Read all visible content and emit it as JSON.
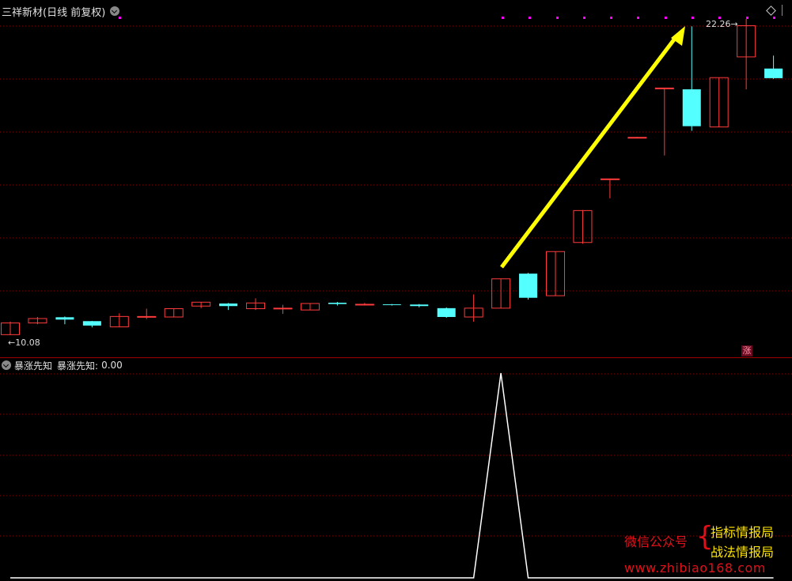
{
  "header": {
    "title": "三祥新材",
    "period": "(日线 前复权)"
  },
  "price_labels": {
    "low": "10.08",
    "high": "22.26"
  },
  "badge": "涨",
  "indicator": {
    "name": "暴涨先知",
    "value_label": "暴涨先知:",
    "value": "0.00"
  },
  "watermark": {
    "wechat": "微信公众号",
    "brace": "{",
    "line1": "指标情报局",
    "line2": "战法情报局",
    "url": "www.zhibiao168.com"
  },
  "colors": {
    "up": "#ff3b3b",
    "down": "#54ffff",
    "signal": "#ffff00",
    "grid": "#8b0000",
    "dots": "#ff00ff",
    "line": "#ffffff"
  },
  "chart_data": {
    "type": "candlestick",
    "scale": {
      "low": 10.08,
      "high": 22.26
    },
    "candles": [
      {
        "o": 10.1,
        "h": 10.6,
        "l": 10.08,
        "c": 10.55
      },
      {
        "o": 10.55,
        "h": 10.78,
        "l": 10.5,
        "c": 10.72
      },
      {
        "o": 10.77,
        "h": 10.8,
        "l": 10.5,
        "c": 10.68
      },
      {
        "o": 10.62,
        "h": 10.63,
        "l": 10.38,
        "c": 10.45
      },
      {
        "o": 10.4,
        "h": 10.92,
        "l": 10.38,
        "c": 10.8
      },
      {
        "o": 10.8,
        "h": 11.1,
        "l": 10.7,
        "c": 10.8
      },
      {
        "o": 10.78,
        "h": 11.1,
        "l": 10.77,
        "c": 11.1
      },
      {
        "o": 11.2,
        "h": 11.35,
        "l": 11.12,
        "c": 11.35
      },
      {
        "o": 11.3,
        "h": 11.32,
        "l": 11.05,
        "c": 11.2
      },
      {
        "o": 11.1,
        "h": 11.5,
        "l": 11.05,
        "c": 11.32
      },
      {
        "o": 11.12,
        "h": 11.25,
        "l": 10.9,
        "c": 11.12
      },
      {
        "o": 11.05,
        "h": 11.3,
        "l": 11.05,
        "c": 11.3
      },
      {
        "o": 11.33,
        "h": 11.36,
        "l": 11.22,
        "c": 11.28
      },
      {
        "o": 11.27,
        "h": 11.32,
        "l": 11.22,
        "c": 11.27
      },
      {
        "o": 11.27,
        "h": 11.28,
        "l": 11.22,
        "c": 11.26
      },
      {
        "o": 11.26,
        "h": 11.28,
        "l": 11.15,
        "c": 11.2
      },
      {
        "o": 11.12,
        "h": 11.15,
        "l": 10.75,
        "c": 10.78
      },
      {
        "o": 10.78,
        "h": 11.65,
        "l": 10.6,
        "c": 11.12
      },
      {
        "o": 11.12,
        "h": 12.25,
        "l": 11.12,
        "c": 12.25
      },
      {
        "o": 12.45,
        "h": 12.48,
        "l": 11.45,
        "c": 11.52
      },
      {
        "o": 11.6,
        "h": 13.3,
        "l": 11.6,
        "c": 13.3
      },
      {
        "o": 13.65,
        "h": 14.9,
        "l": 13.6,
        "c": 14.88
      },
      {
        "o": 16.08,
        "h": 16.1,
        "l": 15.35,
        "c": 16.1
      },
      {
        "o": 17.7,
        "h": 17.72,
        "l": 17.7,
        "c": 17.7
      },
      {
        "o": 19.57,
        "h": 19.6,
        "l": 17.0,
        "c": 19.6
      },
      {
        "o": 19.55,
        "h": 21.98,
        "l": 17.95,
        "c": 18.13
      },
      {
        "o": 18.1,
        "h": 20.0,
        "l": 18.1,
        "c": 20.0
      },
      {
        "o": 20.8,
        "h": 22.26,
        "l": 19.55,
        "c": 22.0
      },
      {
        "o": 20.35,
        "h": 20.85,
        "l": 19.95,
        "c": 19.98
      }
    ],
    "indicator_values": [
      0,
      0,
      0,
      0,
      0,
      0,
      0,
      0,
      0,
      0,
      0,
      0,
      0,
      0,
      0,
      0,
      0,
      0,
      1,
      0,
      0,
      0,
      0,
      0,
      0,
      0,
      0,
      0,
      0
    ]
  }
}
